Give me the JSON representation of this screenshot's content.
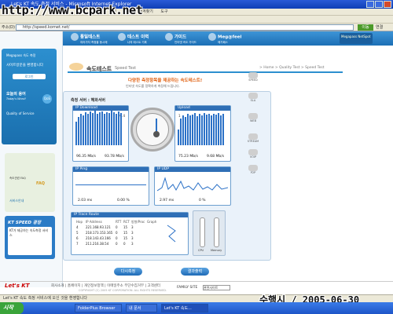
{
  "window": {
    "title": "Let's KT 속도 측정 서비스 - Microsoft Internet Explorer",
    "watermark": "http://www.bcpark.net"
  },
  "menu": [
    "파일",
    "편집",
    "보기",
    "즐겨찾기",
    "도구"
  ],
  "address": {
    "label": "주소(D)",
    "url": "http://speed.kornet.net/",
    "go_label": "이동",
    "links_label": "연결"
  },
  "nav": {
    "items": [
      {
        "label": "통일테스트",
        "sub": "여러가지 측정을 동시에"
      },
      {
        "label": "테스트 이력",
        "sub": "나의 테스트 기록"
      },
      {
        "label": "가이드",
        "sub": "인터넷 속도 가이드"
      },
      {
        "label": "Meg@feel",
        "sub": "메가패스"
      }
    ],
    "user_box": "Megapass NetSpot"
  },
  "sidebar": {
    "logo_text": "Megapass 속도 측정",
    "welcome": "사이트방문을 환영합니다",
    "login_btn": "로그인",
    "today_title": "오늘의 용어",
    "today_sub": "Today's Word!",
    "today_badge": "QoS",
    "today_term": "Quality of Service",
    "help_title": "FAQ",
    "help_items": [
      "속도관련 FAQ",
      "서비스안내"
    ],
    "kt_speed_title": "KT SPEED 광장",
    "kt_speed_text": "KT가 제공하는 속도측정 서비스"
  },
  "page": {
    "title": "속도테스트",
    "title_en": "Speed Test",
    "breadcrumb": "> Home > Quality Test > Speed Test",
    "headline": "다양한 측정항목을 제공하는 속도테스트!",
    "headsub": "인터넷 속도를 정확하게 측정해 드립니다."
  },
  "panel": {
    "title": "측정 서버 : 혜화서버",
    "download": {
      "label": "IP Download",
      "value": "96.35 Mb/s",
      "avg": "93.78 Mb/s",
      "peak": "99.4"
    },
    "upload": {
      "label": "Upload",
      "value": "75.23 Mb/s",
      "avg": "9.68 Mb/s",
      "peak": "1"
    },
    "ping": {
      "label": "IP Ping",
      "value": "2.03 ms",
      "loss": "0.00 %"
    },
    "udp": {
      "label": "IP UDP",
      "value": "2.97 ms",
      "loss": "0 %"
    },
    "trace": {
      "label": "IP Trace Route",
      "headers": [
        "Hop",
        "IP Address",
        "RTT",
        "RCT",
        "방향/Proc",
        "Graph"
      ],
      "rows": [
        [
          "4",
          "221.168.93.121",
          "0",
          "15",
          "3"
        ],
        [
          "5",
          "218.173.153.165",
          "0",
          "15",
          "3"
        ],
        [
          "6",
          "218.143.43.166",
          "0",
          "15",
          "3"
        ],
        [
          "7",
          "211.216.38.54",
          "0",
          "0",
          "3"
        ]
      ]
    },
    "gauges": [
      "CPU",
      "Memory"
    ]
  },
  "actions": {
    "test_btn": "다시측정",
    "result_btn": "결과출력"
  },
  "right_icons": [
    "SPEED",
    "SLA",
    "WEB",
    "STREAM",
    "VOIP",
    "P2P"
  ],
  "footer": {
    "logo": "Let's KT",
    "links": "회사소개 | 홈페이지 | 개인정보정책 | 이메일주소 무단수집거부 | 고객센터",
    "copyright": "COPYRIGHT (C) 2005 KT CORPORATION. ALL RIGHTS RESERVED.",
    "family_label": "FAMILY SITE",
    "family_select": "관련사이트"
  },
  "status": {
    "text": "Let's KT 속도 측정 서비스에 오신 것을 환영합니다",
    "timestamp": "수행시 / 2005-06-30 14:49:37"
  },
  "taskbar": {
    "start": "시작",
    "tasks": [
      "FolderPlus Browser",
      "내 문서",
      "Let's KT 속도..."
    ]
  },
  "colors": {
    "brand_blue": "#2c8fcf",
    "nav_blue": "#1c6fb5",
    "accent_orange": "#e06010"
  }
}
